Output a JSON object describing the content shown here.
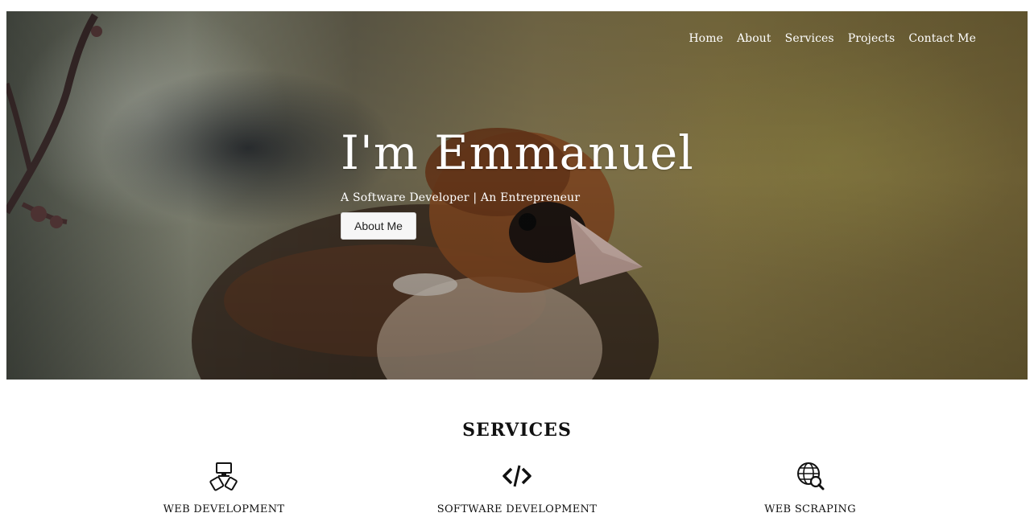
{
  "nav": {
    "items": [
      "Home",
      "About",
      "Services",
      "Projects",
      "Contact Me"
    ]
  },
  "hero": {
    "title": "I'm Emmanuel",
    "subtitle": "A Software Developer | An Entrepreneur",
    "button_label": "About Me"
  },
  "services": {
    "title": "SERVICES",
    "items": [
      {
        "label": "WEB DEVELOPMENT",
        "icon": "devices-icon"
      },
      {
        "label": "SOFTWARE DEVELOPMENT",
        "icon": "code-icon"
      },
      {
        "label": "WEB SCRAPING",
        "icon": "globe-search-icon"
      }
    ]
  },
  "colors": {
    "nav_text": "#ffffff",
    "button_bg": "#f6f6f6",
    "heading_text": "#111111"
  }
}
